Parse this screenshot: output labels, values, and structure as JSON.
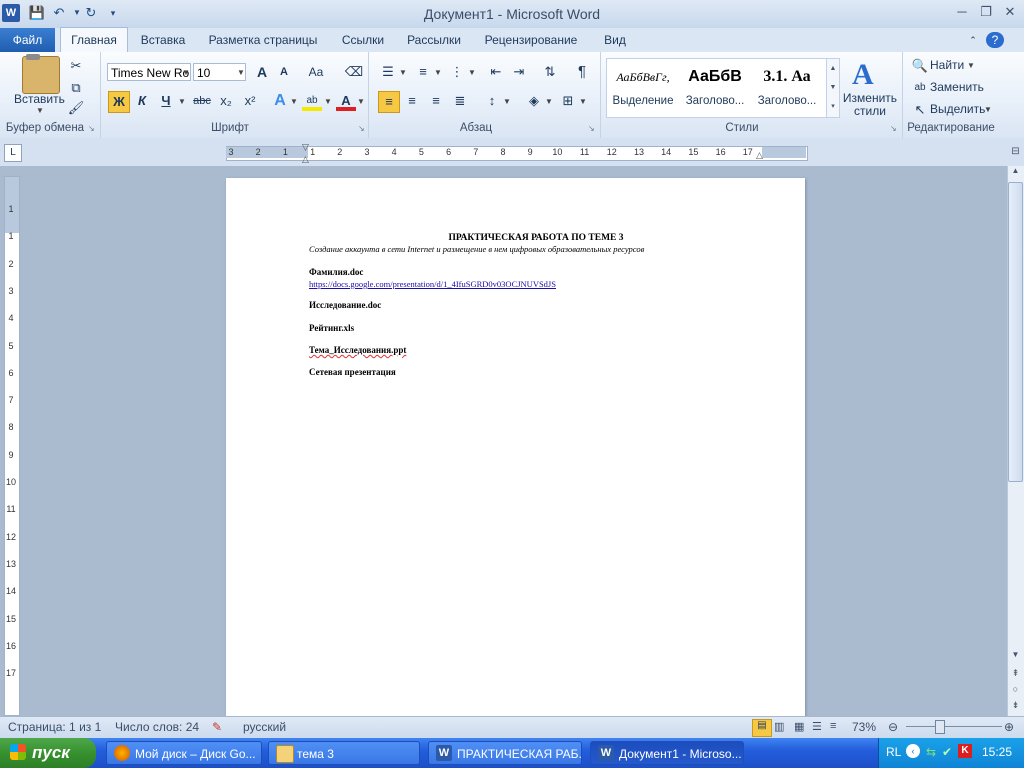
{
  "window": {
    "title": "Документ1 - Microsoft Word"
  },
  "ribbon_tabs": {
    "file": "Файл",
    "home": "Главная",
    "insert": "Вставка",
    "layout": "Разметка страницы",
    "references": "Ссылки",
    "mailings": "Рассылки",
    "review": "Рецензирование",
    "view": "Вид"
  },
  "clipboard": {
    "paste": "Вставить",
    "group_label": "Буфер обмена"
  },
  "font": {
    "family": "Times New Ro",
    "size": "10",
    "bold": "Ж",
    "italic": "К",
    "underline": "Ч",
    "strike": "abc",
    "subscript": "x₂",
    "superscript": "x²",
    "grow": "A",
    "shrink": "A",
    "change_case": "Aa",
    "group_label": "Шрифт"
  },
  "paragraph": {
    "group_label": "Абзац",
    "pilcrow": "¶"
  },
  "styles": {
    "items": [
      {
        "preview": "АаБбВвГг,",
        "label": "Выделение"
      },
      {
        "preview": "АаБбВ",
        "label": "Заголово..."
      },
      {
        "preview": "3.1. Аа",
        "label": "Заголово..."
      }
    ],
    "change_styles": "Изменить стили",
    "group_label": "Стили"
  },
  "editing": {
    "find": "Найти",
    "replace": "Заменить",
    "select": "Выделить",
    "group_label": "Редактирование"
  },
  "document": {
    "heading": "ПРАКТИЧЕСКАЯ РАБОТА ПО ТЕМЕ 3",
    "subheading": "Создание аккаунта в сети Internet и размещение в нем цифровых образовательных ресурсов",
    "lines": [
      {
        "text": "Фамилия.doc",
        "link": "https://docs.google.com/presentation/d/1_4IfuSGRD0v03OCJNUVSdJS"
      },
      {
        "text": "Исследование.doc"
      },
      {
        "text": "Рейтинг.xls"
      },
      {
        "text": "Тема_Исследования.ppt"
      },
      {
        "text": "Сетевая презентация"
      }
    ]
  },
  "ruler": {
    "h_numbers": [
      "3",
      "2",
      "1",
      "1",
      "2",
      "3",
      "4",
      "5",
      "6",
      "7",
      "8",
      "9",
      "10",
      "11",
      "12",
      "13",
      "14",
      "15",
      "16",
      "17"
    ],
    "v_numbers": [
      "1",
      "1",
      "2",
      "3",
      "4",
      "5",
      "6",
      "7",
      "8",
      "9",
      "10",
      "11",
      "12",
      "13",
      "14",
      "15",
      "16",
      "17"
    ]
  },
  "status": {
    "page": "Страница: 1 из 1",
    "words": "Число слов: 24",
    "language": "русский",
    "zoom": "73%"
  },
  "taskbar": {
    "start": "пуск",
    "items": [
      "Мой диск – Диск Go...",
      "тема 3",
      "ПРАКТИЧЕСКАЯ РАБ...",
      "Документ1 - Microso..."
    ],
    "lang": "RL",
    "clock": "15:25"
  }
}
